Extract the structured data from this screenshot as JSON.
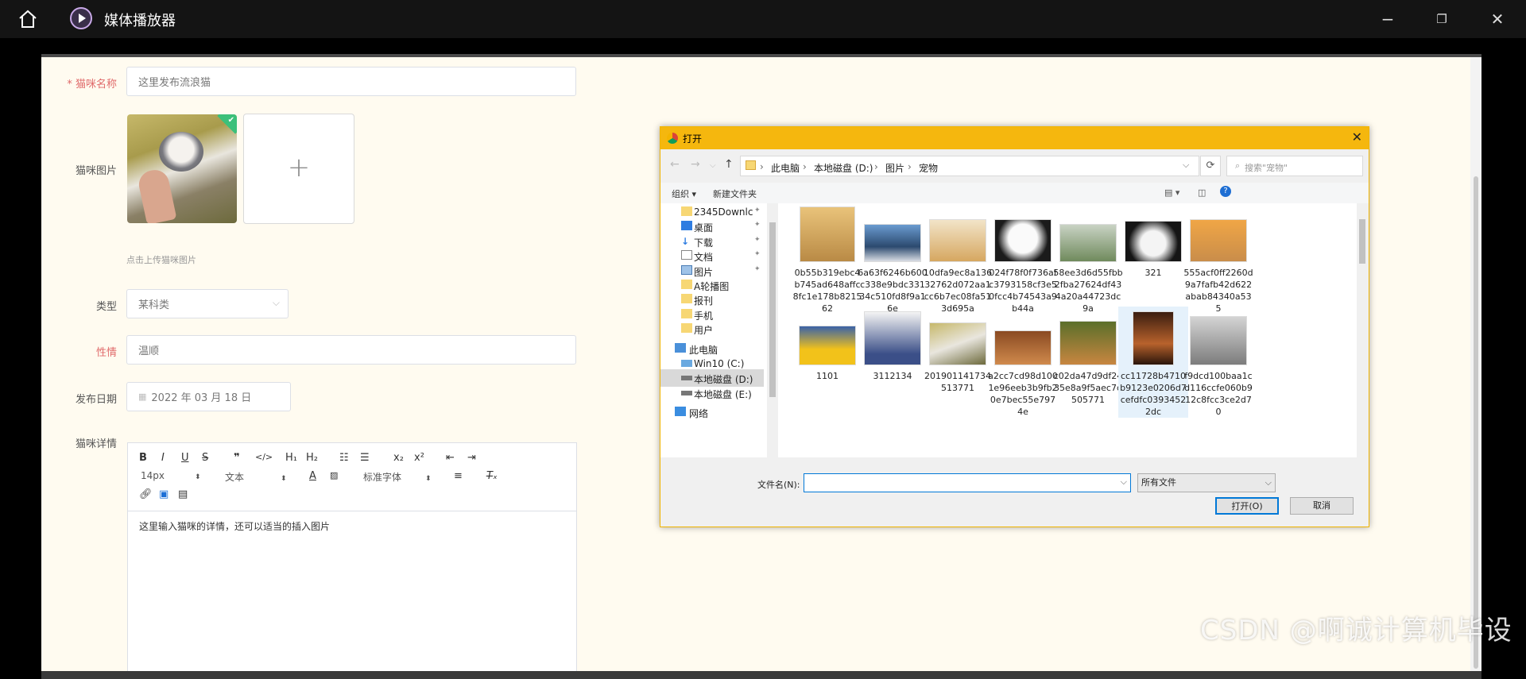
{
  "window": {
    "title": "媒体播放器",
    "icon": "play-circle-icon"
  },
  "form": {
    "name_label": "猫咪名称",
    "name_placeholder": "这里发布流浪猫",
    "photo_label": "猫咪图片",
    "photo_hint": "点击上传猫咪图片",
    "type_label": "类型",
    "type_value": "某科类",
    "temper_label": "性情",
    "temper_value": "温顺",
    "date_label": "发布日期",
    "date_value": "2022 年 03 月 18 日",
    "detail_label": "猫咪详情",
    "editor": {
      "font_size": "14px",
      "paragraph": "文本",
      "font_family": "标准字体",
      "content": "这里输入猫咪的详情，还可以适当的插入图片"
    }
  },
  "dialog": {
    "title": "打开",
    "breadcrumb": [
      "此电脑",
      "本地磁盘 (D:)",
      "图片",
      "宠物"
    ],
    "search_placeholder": "搜索\"宠物\"",
    "organize_label": "组织 ▾",
    "new_folder_label": "新建文件夹",
    "tree": [
      {
        "label": "2345Downlc",
        "icon": "folder-icon",
        "pinned": true
      },
      {
        "label": "桌面",
        "icon": "desktop-icon",
        "pinned": true
      },
      {
        "label": "下载",
        "icon": "download-icon",
        "pinned": true
      },
      {
        "label": "文档",
        "icon": "document-icon",
        "pinned": true
      },
      {
        "label": "图片",
        "icon": "pictures-icon",
        "pinned": true
      },
      {
        "label": "A轮播图",
        "icon": "folder-icon",
        "pinned": false
      },
      {
        "label": "报刊",
        "icon": "folder-icon",
        "pinned": false
      },
      {
        "label": "手机",
        "icon": "folder-icon",
        "pinned": false
      },
      {
        "label": "用户",
        "icon": "folder-icon",
        "pinned": false
      },
      {
        "label": "此电脑",
        "icon": "computer-icon",
        "pinned": false
      },
      {
        "label": "Win10 (C:)",
        "icon": "drive-icon",
        "pinned": false
      },
      {
        "label": "本地磁盘 (D:)",
        "icon": "drive-icon",
        "pinned": false
      },
      {
        "label": "本地磁盘 (E:)",
        "icon": "drive-icon",
        "pinned": false
      },
      {
        "label": "网络",
        "icon": "network-icon",
        "pinned": false
      }
    ],
    "files_row1": [
      {
        "name": "0b55b319ebc4b745ad648affc8fc1e178b821562"
      },
      {
        "name": "6a63f6246b600c338e9bdc33134c510fd8f9a16e"
      },
      {
        "name": "10dfa9ec8a13632762d072aa1cc6b7ec08fa513d695a"
      },
      {
        "name": "024f78f0f736afc3793158cf3e50fcc4b74543a9b44a"
      },
      {
        "name": "58ee3d6d55fbb2fba27624df434a20a44723dc9a"
      },
      {
        "name": "321"
      },
      {
        "name": "555acf0ff2260d9a7fafb42d622abab84340a535"
      }
    ],
    "files_row2": [
      {
        "name": "1101"
      },
      {
        "name": "3112134"
      },
      {
        "name": "201901141734513771"
      },
      {
        "name": "a2cc7cd98d1001e96eeb3b9fb20e7bec55e7974e"
      },
      {
        "name": "c02da47d9df2435e8a9f5aec7d505771"
      },
      {
        "name": "cc11728b4710b9123e0206d7cefdfc03934522dc"
      },
      {
        "name": "f9dcd100baa1cd116ccfe060b912c8fcc3ce2d70"
      }
    ],
    "filename_label": "文件名(N):",
    "filename_value": "",
    "filetype_value": "所有文件",
    "open_button": "打开(O)",
    "cancel_button": "取消"
  },
  "watermark": "CSDN @啊诚计算机毕设"
}
